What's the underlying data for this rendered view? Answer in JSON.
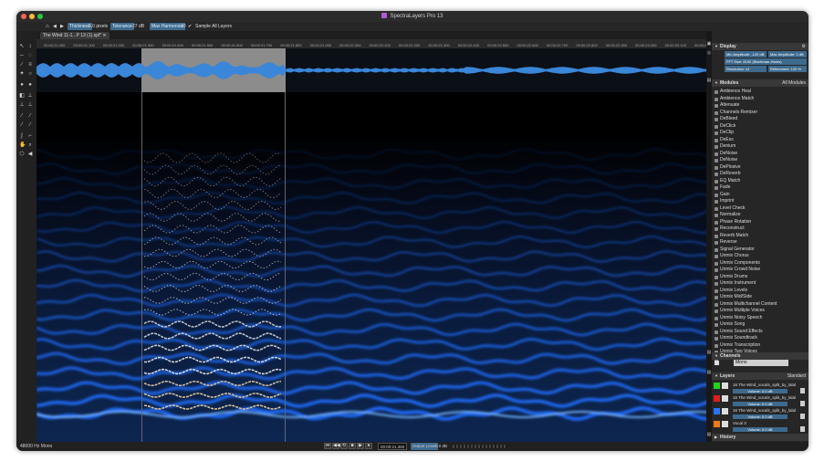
{
  "window": {
    "title": "SpectraLayers Pro 13"
  },
  "toolbar": {
    "thickness_label": "Thickness",
    "thickness_value": "5.0 pixels",
    "tolerance_label": "Tolerance",
    "tolerance_value": "27 dB",
    "max_harmonics_label": "Max Harmonics",
    "max_harmonics_value": "40",
    "sample_all_layers": "Sample All Layers"
  },
  "tab": {
    "label": "The Wind 11-1...P 13 (1).spl*"
  },
  "ruler": {
    "ticks": [
      "00:00:21.000",
      "00:00:21.100",
      "00:00:21.200",
      "00:00:21.300",
      "00:00:21.400",
      "00:00:21.500",
      "00:00:21.600",
      "00:00:21.700",
      "00:00:21.800",
      "00:00:21.900",
      "00:00:22.000",
      "00:00:22.100",
      "00:00:22.200",
      "00:00:22.300",
      "00:00:22.400",
      "00:00:22.500",
      "00:00:22.600",
      "00:00:22.700",
      "00:00:22.800",
      "00:00:22.900",
      "00:00:23.000",
      "00:00:23.100",
      "00:00:23.200"
    ]
  },
  "display": {
    "title": "Display",
    "min_amplitude": "Min Amplitude: -120 dB",
    "max_amplitude": "Max Amplitude: 0 dB",
    "fft": "FFT Size: 8192 (Blackman-Harris)",
    "resolution": "Resolution: x4",
    "refinement": "Refinement: 100 %"
  },
  "modules": {
    "title": "Modules",
    "filter": "All Modules",
    "items": [
      "Ambience Heal",
      "Ambience Match",
      "Attenuate",
      "Channels Remixer",
      "DeBleed",
      "DeClick",
      "DeClip",
      "DeEss",
      "Denium",
      "DeNoise",
      "DeNoise",
      "DePlosive",
      "DeReverb",
      "EQ Match",
      "Fade",
      "Gain",
      "Imprint",
      "Level Check",
      "Normalize",
      "Phase Rotation",
      "Reconstruct",
      "Reverb Match",
      "Reverse",
      "Signal Generator",
      "Unmix Chorus",
      "Unmix Components",
      "Unmix Crowd Noise",
      "Unmix Drums",
      "Unmix Instrument",
      "Unmix Levels",
      "Unmix Mid/Side",
      "Unmix Multichannel Content",
      "Unmix Multiple Voices",
      "Unmix Noisy Speech",
      "Unmix Song",
      "Unmix Sound Effects",
      "Unmix Soundtrack",
      "Unmix Transcription",
      "Unmix Two Voices",
      "Modules Chain"
    ]
  },
  "channels": {
    "title": "Channels",
    "mono": "Mono"
  },
  "layers": {
    "title": "Layers",
    "blend": "Standard",
    "items": [
      {
        "name": "16 The Wind_vocals_split_by_lalal",
        "volume": "Volume: 0.0 dB",
        "color": "#21d31a"
      },
      {
        "name": "16 The Wind_vocals_split_by_lalal",
        "volume": "Volume: 0.0 dB",
        "color": "#e21c1c"
      },
      {
        "name": "16 The Wind_vocals_split_by_lalal",
        "volume": "Volume: 0.0 dB",
        "color": "#2873ff"
      },
      {
        "name": "Vocal 3",
        "volume": "Volume: 0.0 dB",
        "color": "#f07b15"
      }
    ]
  },
  "history": {
    "title": "History"
  },
  "status": {
    "format": "48000 Hz Mono",
    "timecode": "00:00:21.360",
    "output_level_label": "Output Level",
    "output_level_value": "0.0 dB"
  },
  "colors": {
    "accent": "#3f6b8f",
    "spectro": "#1f6dff",
    "harmonic": "#e8e8e8"
  }
}
